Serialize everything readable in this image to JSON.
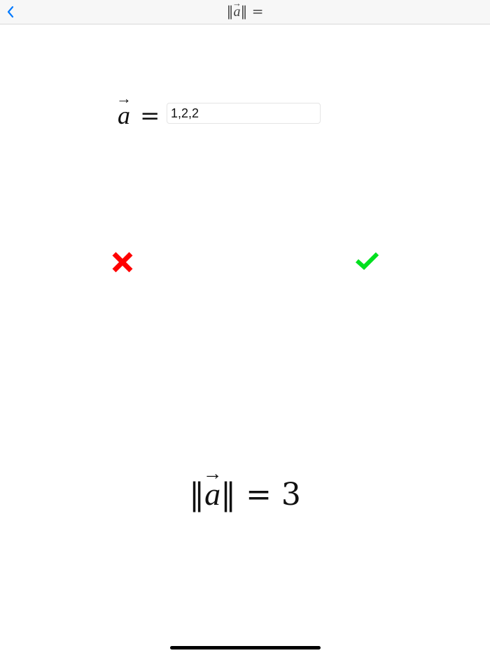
{
  "navbar": {
    "back_icon": "chevron-left-icon",
    "title_prefix": "‖",
    "title_var": "a",
    "title_arrow": "→",
    "title_suffix": "‖ ="
  },
  "input_row": {
    "label_var": "a",
    "label_arrow": "→",
    "label_eq": "=",
    "value": "1,2,2"
  },
  "actions": {
    "clear_icon": "x-icon",
    "confirm_icon": "checkmark-icon",
    "clear_color": "#ff0000",
    "confirm_color": "#00e01f"
  },
  "result": {
    "prefix": "‖",
    "var": "a",
    "arrow": "→",
    "suffix": "‖ = 3"
  },
  "colors": {
    "accent": "#007aff"
  }
}
